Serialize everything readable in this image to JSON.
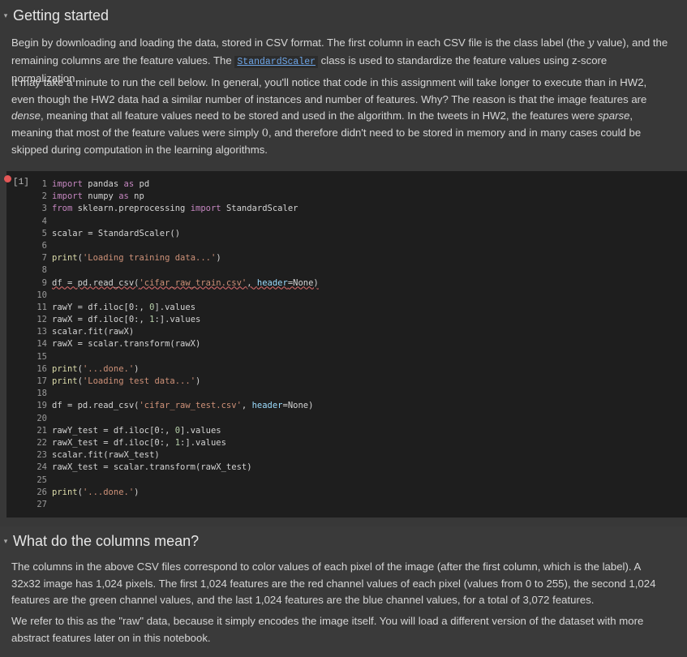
{
  "section1": {
    "heading": "Getting started",
    "para1": {
      "a": "Begin by downloading and loading the data, stored in CSV format. The first column in each CSV file is the class label (the ",
      "var": "y",
      "b": " value), and the remaining columns are the feature values. The ",
      "code": "StandardScaler",
      "c": " class is used to standardize the feature values using z-score normalization."
    },
    "para2": {
      "a": "It may take a minute to run the cell below. In general, you'll notice that code in this assignment will take longer to execute than in HW2, even though the HW2 data had a similar number of instances and number of features. Why? The reason is that the image features are ",
      "em1": "dense",
      "b": ", meaning that all feature values need to be stored and used in the algorithm. In the tweets in HW2, the features were ",
      "em2": "sparse",
      "c": ", meaning that most of the feature values were simply ",
      "zero": "0",
      "d": ", and therefore didn't need to be stored in memory and in many cases could be skipped during computation in the learning algorithms."
    }
  },
  "cell": {
    "exec_count": "[1]",
    "lines": [
      "import pandas as pd",
      "import numpy as np",
      "from sklearn.preprocessing import StandardScaler",
      "",
      "scalar = StandardScaler()",
      "",
      "print('Loading training data...')",
      "",
      "df = pd.read_csv('cifar_raw_train.csv', header=None)",
      "",
      "rawY = df.iloc[0:, 0].values",
      "rawX = df.iloc[0:, 1:].values",
      "scalar.fit(rawX)",
      "rawX = scalar.transform(rawX)",
      "",
      "print('...done.')",
      "print('Loading test data...')",
      "",
      "df = pd.read_csv('cifar_raw_test.csv', header=None)",
      "",
      "rawY_test = df.iloc[0:, 0].values",
      "rawX_test = df.iloc[0:, 1:].values",
      "scalar.fit(rawX_test)",
      "rawX_test = scalar.transform(rawX_test)",
      "",
      "print('...done.')",
      ""
    ]
  },
  "section2": {
    "heading": "What do the columns mean?",
    "para1": "The columns in the above CSV files correspond to color values of each pixel of the image (after the first column, which is the label). A 32x32 image has 1,024 pixels. The first 1,024 features are the red channel values of each pixel (values from 0 to 255), the second 1,024 features are the green channel values, and the last 1,024 features are the blue channel values, for a total of 3,072 features.",
    "para2": "We refer to this as the \"raw\" data, because it simply encodes the image itself. You will load a different version of the dataset with more abstract features later on in this notebook."
  }
}
